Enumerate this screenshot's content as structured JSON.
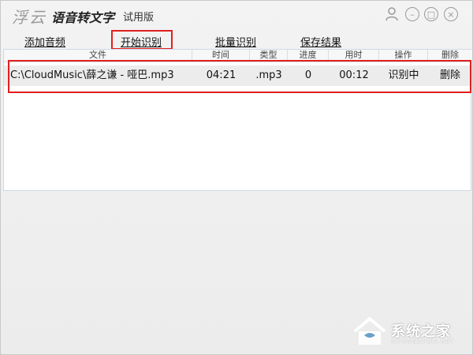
{
  "titlebar": {
    "brand": "浮云",
    "app_title": "语音转文字",
    "edition": "试用版",
    "user_icon": "user-icon",
    "min_glyph": "–",
    "max_glyph": "□",
    "close_glyph": "×"
  },
  "menu": {
    "add_audio": "添加音频",
    "start_recognition": "开始识别",
    "batch_recognition": "批量识别",
    "save_results": "保存结果"
  },
  "table": {
    "columns": [
      "文件",
      "时间",
      "类型",
      "进度",
      "用时",
      "操作",
      "删除"
    ],
    "rows": [
      {
        "file": "C:\\CloudMusic\\薛之谦 - 哑巴.mp3",
        "time": "04:21",
        "type": ".mp3",
        "progress": "0",
        "elapsed": "00:12",
        "action": "识别中",
        "delete": "删除"
      }
    ]
  },
  "watermark": {
    "text": "系统之家",
    "url": "XITONGZHIJIA.NET"
  },
  "colors": {
    "highlight": "#e02020",
    "panel_border": "#cfd8e6"
  }
}
